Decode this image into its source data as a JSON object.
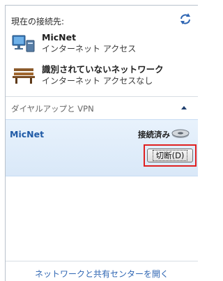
{
  "header": {
    "title": "現在の接続先:",
    "refresh_icon": "refresh-icon"
  },
  "connections": [
    {
      "name": "MicNet",
      "subtitle": "インターネット アクセス",
      "icon": "network-computer-icon"
    },
    {
      "name": "識別されていないネットワーク",
      "subtitle": "インターネット アクセスなし",
      "icon": "public-network-bench-icon"
    }
  ],
  "vpn_section": {
    "label": "ダイヤルアップと VPN",
    "expanded": true,
    "items": [
      {
        "name": "MicNet",
        "status": "接続済み",
        "button_label": "切断(D)",
        "icon": "modem-icon"
      }
    ]
  },
  "footer": {
    "link_label": "ネットワークと共有センターを開く"
  },
  "colors": {
    "link": "#2f66b3",
    "vpn_name": "#1f5aa6",
    "selected_bg": "#dfecf9",
    "highlight_box": "#e02020"
  }
}
